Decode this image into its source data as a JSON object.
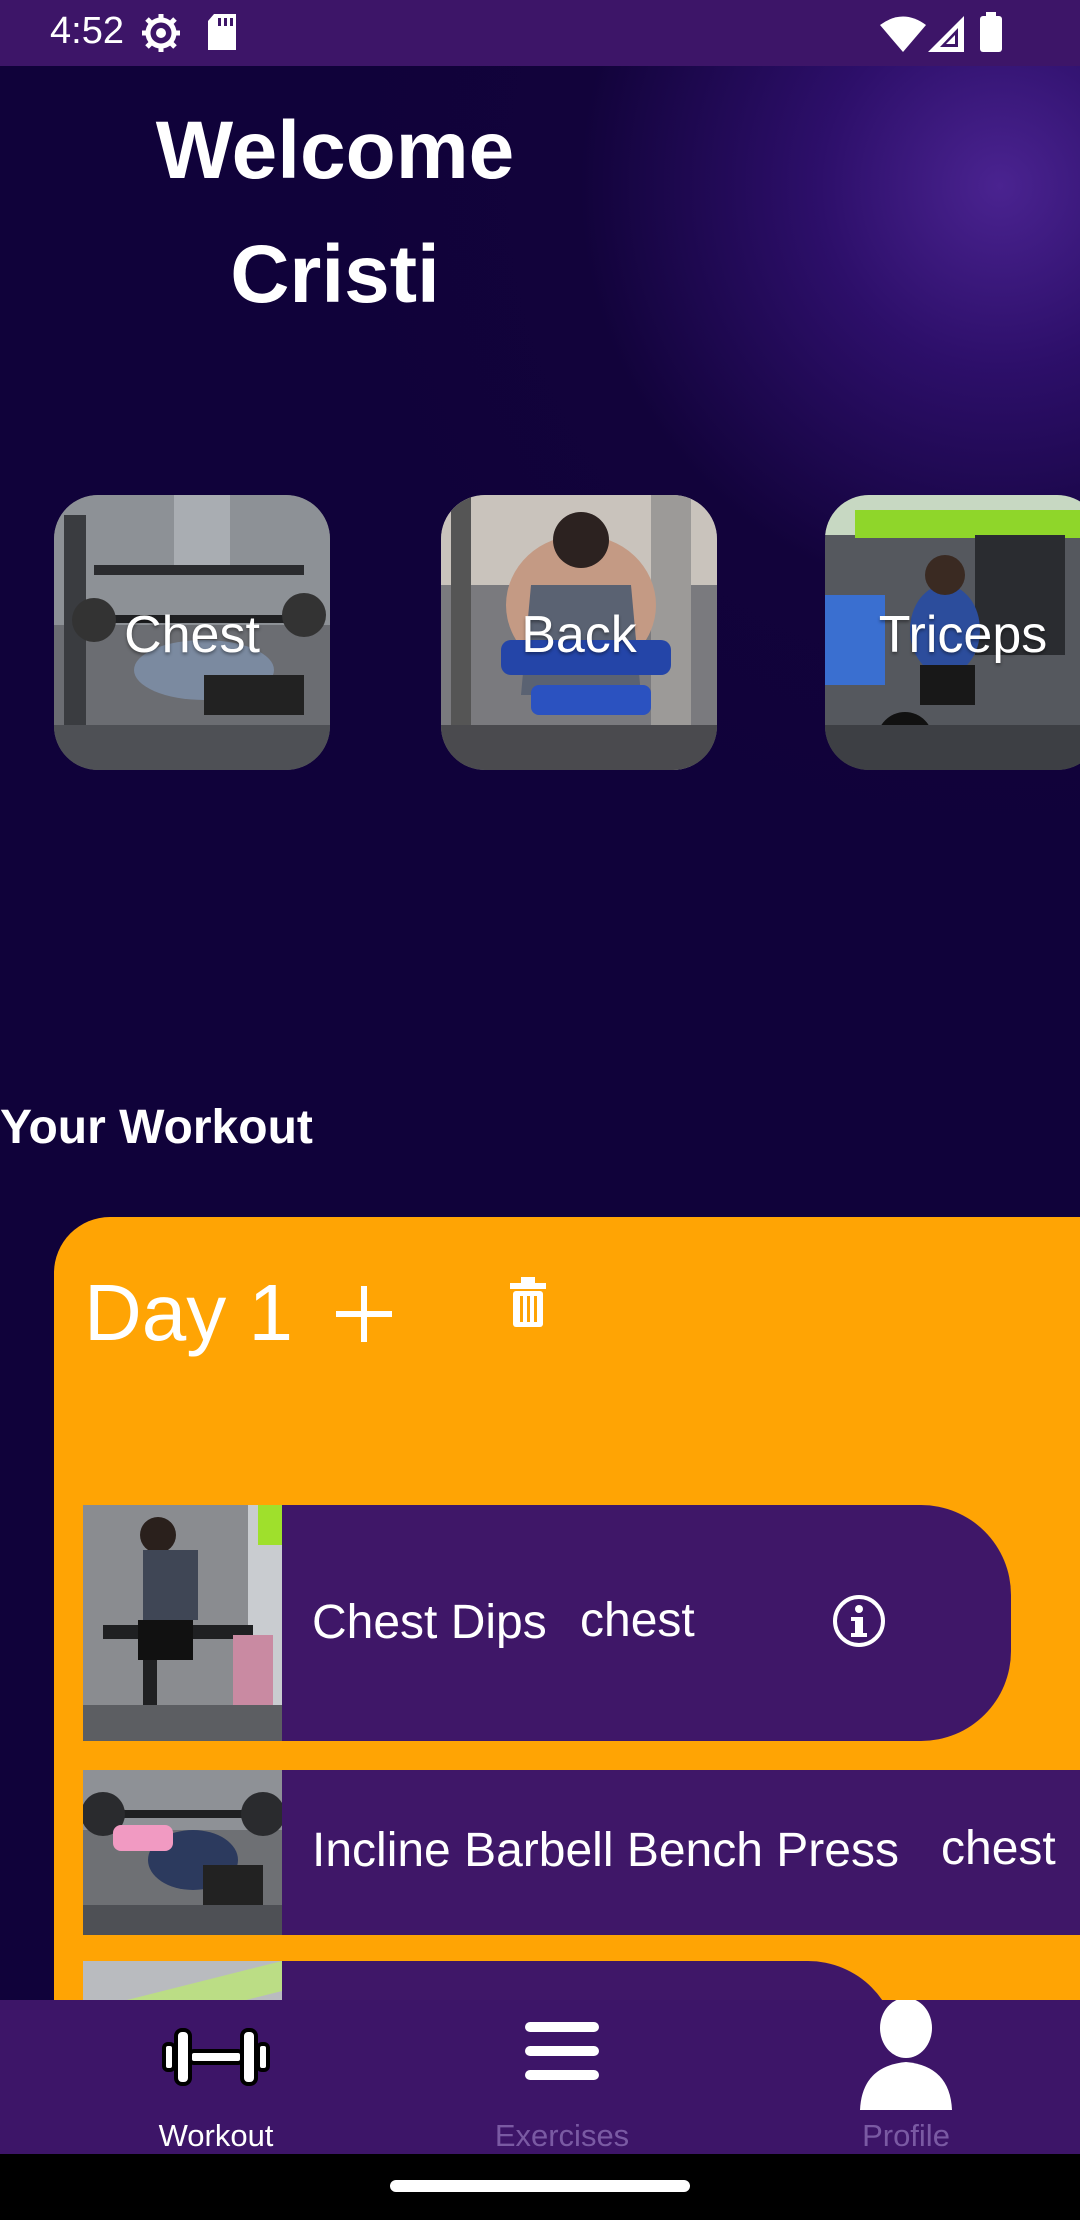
{
  "status_bar": {
    "time": "4:52",
    "icons": [
      "settings-gear-icon",
      "sd-card-icon",
      "wifi-icon",
      "signal-icon",
      "battery-icon"
    ]
  },
  "welcome": {
    "line1": "Welcome",
    "line2": "Cristi"
  },
  "categories": [
    {
      "label": "Chest"
    },
    {
      "label": "Back"
    },
    {
      "label": "Triceps"
    }
  ],
  "workout": {
    "section_title": "Your Workout",
    "day": {
      "title": "Day 1",
      "add_icon": "plus-icon",
      "delete_icon": "trash-icon",
      "exercises": [
        {
          "name": "Chest Dips",
          "muscle": "chest",
          "info_icon": "info-icon"
        },
        {
          "name": "Incline Barbell Bench Press",
          "muscle": "chest"
        },
        {
          "name": "",
          "muscle": ""
        }
      ]
    }
  },
  "bottom_nav": {
    "items": [
      {
        "label": "Workout",
        "icon": "dumbbell-icon",
        "active": true
      },
      {
        "label": "Exercises",
        "icon": "menu-icon",
        "active": false
      },
      {
        "label": "Profile",
        "icon": "person-icon",
        "active": false
      }
    ]
  },
  "colors": {
    "background": "#10023a",
    "bar_purple": "#3d1568",
    "card_orange": "#ffa404",
    "exercise_purple": "#3f1768",
    "inactive_label": "#7a5aa3"
  }
}
